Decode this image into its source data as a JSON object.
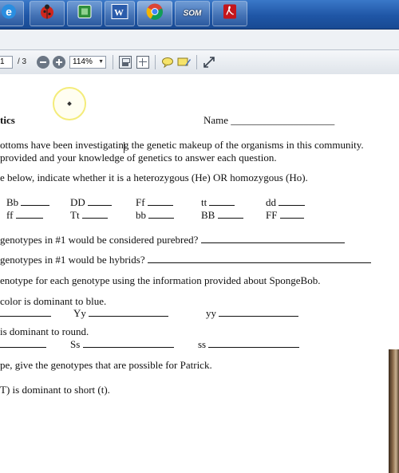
{
  "taskbar": {
    "apps": [
      "internet-explorer",
      "ladybug-app",
      "green-app",
      "word",
      "chrome",
      "som-app",
      "acrobat"
    ],
    "som_label": "SOM",
    "word_label": "W"
  },
  "toolbar": {
    "page_current": "1",
    "page_total": "/ 3",
    "zoom": "114%"
  },
  "document": {
    "title_fragment": "tics",
    "name_label": "Name ____________________",
    "intro_1": "ottoms have been investigating the genetic makeup of the organisms in this community.",
    "intro_2": "provided and your knowledge of genetics to answer each question.",
    "q1": "e below, indicate whether it is a heterozygous (He) OR homozygous (Ho).",
    "geno_row1": [
      "Bb",
      "DD",
      "Ff",
      "tt",
      "dd"
    ],
    "geno_row2": [
      "ff",
      "Tt",
      "bb",
      "BB",
      "FF"
    ],
    "q2": "genotypes in #1 would be considered purebred?",
    "q3": "genotypes in #1 would be hybrids?",
    "q4": "enotype for each genotype using the information provided about SpongeBob.",
    "q4a": "color is dominant to blue.",
    "q4a_geno": [
      "Yy",
      "yy"
    ],
    "q4b": "is dominant to round.",
    "q4b_geno": [
      "Ss",
      "ss"
    ],
    "q5": "pe, give the genotypes that are possible for Patrick.",
    "q5a": "T) is dominant to short (t)."
  }
}
